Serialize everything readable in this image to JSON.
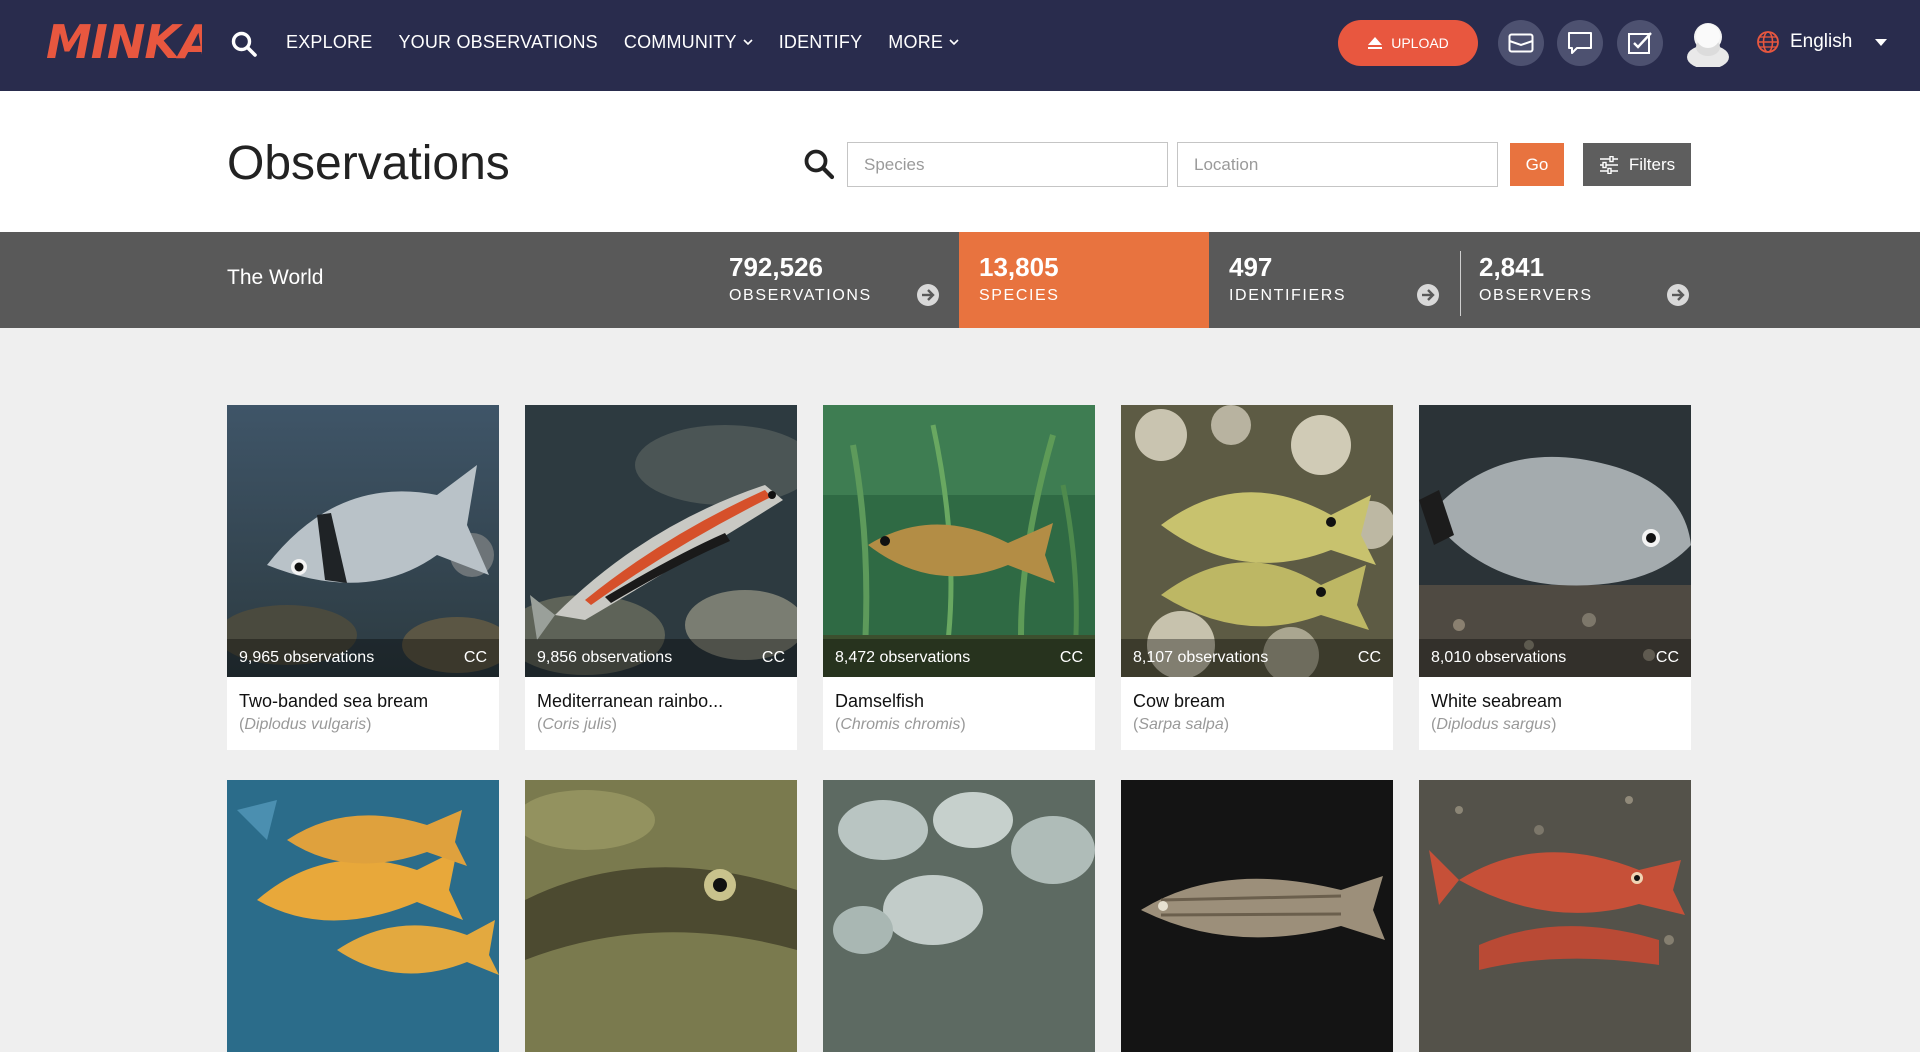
{
  "brand": {
    "logo_text": "MINKA",
    "accent": "#e8573f",
    "navbar_bg": "#292c4d"
  },
  "nav": {
    "items": [
      {
        "label": "EXPLORE",
        "dropdown": false
      },
      {
        "label": "YOUR OBSERVATIONS",
        "dropdown": false
      },
      {
        "label": "COMMUNITY",
        "dropdown": true
      },
      {
        "label": "IDENTIFY",
        "dropdown": false
      },
      {
        "label": "MORE",
        "dropdown": true
      }
    ],
    "upload_label": "UPLOAD",
    "icons": [
      "envelope-icon",
      "chat-icon",
      "checkbox-icon"
    ],
    "language": "English"
  },
  "page": {
    "title": "Observations",
    "species_placeholder": "Species",
    "location_placeholder": "Location",
    "go_label": "Go",
    "filters_label": "Filters"
  },
  "stats": {
    "place": "The World",
    "items": [
      {
        "value": "792,526",
        "label": "OBSERVATIONS",
        "active": false
      },
      {
        "value": "13,805",
        "label": "SPECIES",
        "active": true
      },
      {
        "value": "497",
        "label": "IDENTIFIERS",
        "active": false
      },
      {
        "value": "2,841",
        "label": "OBSERVERS",
        "active": false
      }
    ]
  },
  "species": [
    {
      "common": "Two-banded sea bream",
      "scientific": "Diplodus vulgaris",
      "observations": "9,965 observations",
      "license": "CC"
    },
    {
      "common": "Mediterranean rainbo...",
      "scientific": "Coris julis",
      "observations": "9,856 observations",
      "license": "CC"
    },
    {
      "common": "Damselfish",
      "scientific": "Chromis chromis",
      "observations": "8,472 observations",
      "license": "CC"
    },
    {
      "common": "Cow bream",
      "scientific": "Sarpa salpa",
      "observations": "8,107 observations",
      "license": "CC"
    },
    {
      "common": "White seabream",
      "scientific": "Diplodus sargus",
      "observations": "8,010 observations",
      "license": "CC"
    }
  ]
}
